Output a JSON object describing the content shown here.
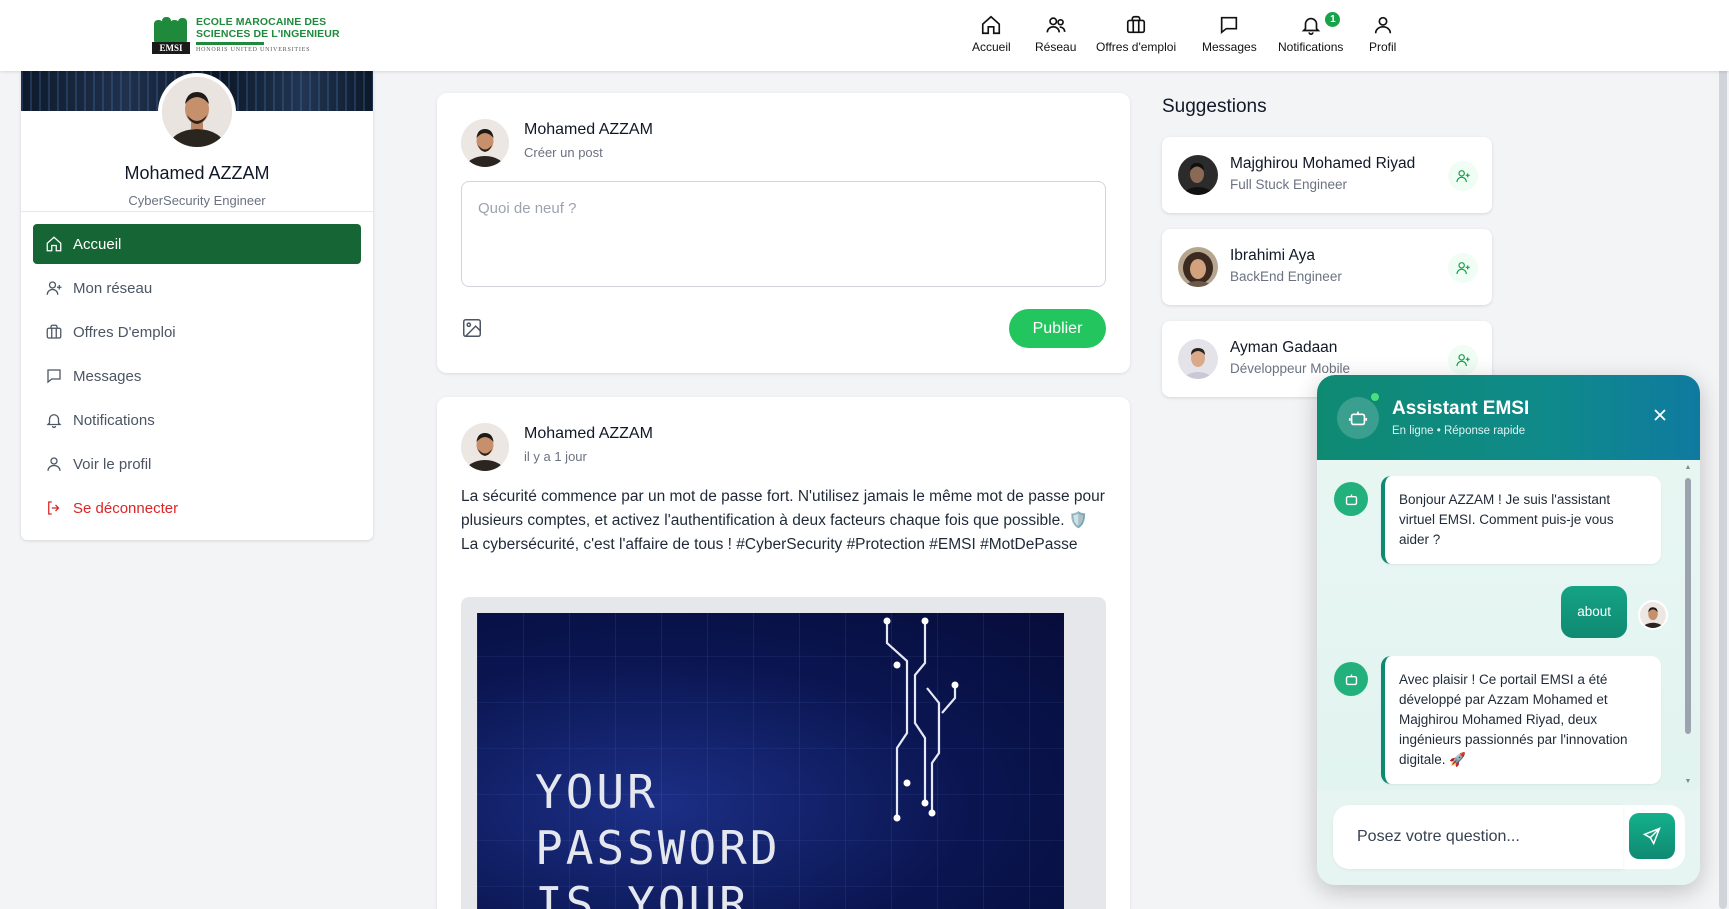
{
  "logo": {
    "line1": "ECOLE MAROCAINE DES",
    "line2": "SCIENCES DE L'INGENIEUR",
    "sub": "HONORIS UNITED UNIVERSITIES",
    "mark": "EMSI",
    "color": "#1f8a3c"
  },
  "nav": [
    {
      "label": "Accueil",
      "icon": "home-icon"
    },
    {
      "label": "Réseau",
      "icon": "users-icon"
    },
    {
      "label": "Offres d'emploi",
      "icon": "briefcase-icon"
    },
    {
      "label": "Messages",
      "icon": "message-icon"
    },
    {
      "label": "Notifications",
      "icon": "bell-icon",
      "badge": "1"
    },
    {
      "label": "Profil",
      "icon": "user-icon"
    }
  ],
  "profile": {
    "name": "Mohamed AZZAM",
    "role": "CyberSecurity Engineer"
  },
  "menu": [
    {
      "label": "Accueil",
      "icon": "home-icon",
      "active": true
    },
    {
      "label": "Mon réseau",
      "icon": "user-plus-icon"
    },
    {
      "label": "Offres D'emploi",
      "icon": "briefcase-icon"
    },
    {
      "label": "Messages",
      "icon": "message-icon"
    },
    {
      "label": "Notifications",
      "icon": "bell-icon"
    },
    {
      "label": "Voir le profil",
      "icon": "user-icon"
    },
    {
      "label": "Se déconnecter",
      "icon": "logout-icon",
      "danger": true
    }
  ],
  "composer": {
    "author": "Mohamed AZZAM",
    "subtitle": "Créer un post",
    "placeholder": "Quoi de neuf ?",
    "publish_label": "Publier"
  },
  "post": {
    "author": "Mohamed AZZAM",
    "time": "il y a 1 jour",
    "text": "La sécurité commence par un mot de passe fort. N'utilisez jamais le même mot de passe pour plusieurs comptes, et activez l'authentification à deux facteurs chaque fois que possible. 🛡️ La cybersécurité, c'est l'affaire de tous ! #CyberSecurity #Protection #EMSI #MotDePasse",
    "image_line1": "YOUR",
    "image_line2": "PASSWORD",
    "image_line3": "IS YOUR"
  },
  "suggestions": {
    "title": "Suggestions",
    "items": [
      {
        "name": "Majghirou Mohamed Riyad",
        "role": "Full Stuck Engineer"
      },
      {
        "name": "Ibrahimi Aya",
        "role": "BackEnd Engineer"
      },
      {
        "name": "Ayman Gadaan",
        "role": "Développeur Mobile"
      }
    ]
  },
  "chat": {
    "title": "Assistant EMSI",
    "status": "En ligne • Réponse rapide",
    "messages": [
      {
        "from": "bot",
        "text": "Bonjour AZZAM ! Je suis l'assistant virtuel EMSI. Comment puis-je vous aider ?"
      },
      {
        "from": "user",
        "text": "about"
      },
      {
        "from": "bot",
        "text": "Avec plaisir ! Ce portail EMSI a été développé par Azzam Mohamed et Majghirou Mohamed Riyad, deux ingénieurs passionnés par l'innovation digitale. 🚀"
      }
    ],
    "input_placeholder": "Posez votre question...",
    "accent": "#0f8a72"
  }
}
